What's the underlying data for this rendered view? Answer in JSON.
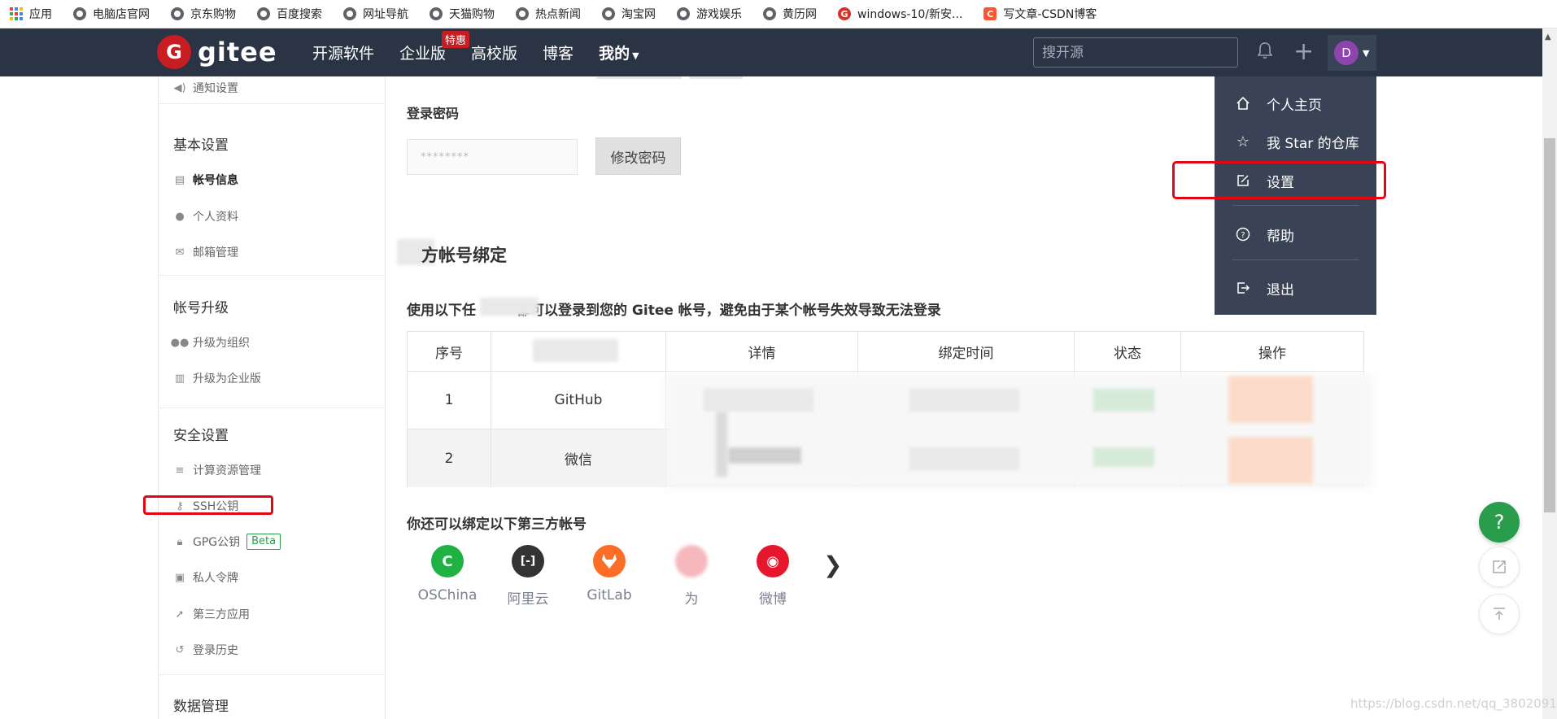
{
  "bookmarks": [
    {
      "label": "应用",
      "icon": "apps-icon"
    },
    {
      "label": "电脑店官网",
      "icon": "globe-icon"
    },
    {
      "label": "京东购物",
      "icon": "globe-icon"
    },
    {
      "label": "百度搜索",
      "icon": "globe-icon"
    },
    {
      "label": "网址导航",
      "icon": "globe-icon"
    },
    {
      "label": "天猫购物",
      "icon": "globe-icon"
    },
    {
      "label": "热点新闻",
      "icon": "globe-icon"
    },
    {
      "label": "淘宝网",
      "icon": "globe-icon"
    },
    {
      "label": "游戏娱乐",
      "icon": "globe-icon"
    },
    {
      "label": "黄历网",
      "icon": "globe-icon"
    },
    {
      "label": "windows-10/新安...",
      "icon": "gitee-icon"
    },
    {
      "label": "写文章-CSDN博客",
      "icon": "csdn-icon"
    }
  ],
  "navbar": {
    "logo_mark": "G",
    "logo_text": "gitee",
    "links": [
      "开源软件",
      "企业版",
      "高校版",
      "博客",
      "我的"
    ],
    "enterprise_badge": "特惠",
    "search_placeholder": "搜开源",
    "avatar_letter": "D"
  },
  "dropdown": {
    "items": [
      "个人主页",
      "我 Star 的仓库",
      "设置",
      "帮助",
      "退出"
    ]
  },
  "sidebar": {
    "top_item": "通知设置",
    "sections": [
      {
        "title": "基本设置",
        "items": [
          "帐号信息",
          "个人资料",
          "邮箱管理"
        ]
      },
      {
        "title": "帐号升级",
        "items": [
          "升级为组织",
          "升级为企业版"
        ]
      },
      {
        "title": "安全设置",
        "items": [
          "计算资源管理",
          "SSH公钥",
          "GPG公钥",
          "私人令牌",
          "第三方应用",
          "登录历史"
        ]
      },
      {
        "title": "数据管理",
        "items": []
      }
    ],
    "beta_badge": "Beta"
  },
  "main": {
    "password_title": "登录密码",
    "password_value": "********",
    "change_password_button": "修改密码",
    "binding_title": "方帐号绑定",
    "binding_desc_prefix": "使用以下任",
    "binding_desc_suffix": "都可以登录到您的 Gitee 帐号，避免由于某个帐号失效导致无法登录",
    "table": {
      "columns": [
        "序号",
        "",
        "详情",
        "绑定时间",
        "状态",
        "操作"
      ],
      "rows": [
        {
          "index": "1",
          "platform": "GitHub"
        },
        {
          "index": "2",
          "platform": "微信"
        }
      ]
    },
    "third_party_title": "你还可以绑定以下第三方帐号",
    "third_party": [
      {
        "label": "OSChina",
        "color": "#1fb141",
        "glyph": "C"
      },
      {
        "label": "阿里云",
        "color": "#333333",
        "glyph": "[-]"
      },
      {
        "label": "GitLab",
        "color": "#fc6d26",
        "glyph": "🦊"
      },
      {
        "label": "为",
        "color": "#e8414a",
        "glyph": ""
      },
      {
        "label": "微博",
        "color": "#e6162d",
        "glyph": "◉"
      }
    ]
  },
  "floating": {
    "help": "?"
  },
  "watermark": "https://blog.csdn.net/qq_3802091..."
}
